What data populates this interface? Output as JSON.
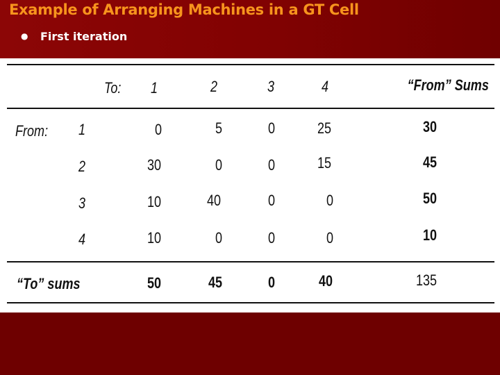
{
  "slide": {
    "title": "Example of Arranging Machines in a GT Cell",
    "bullets": [
      "First iteration"
    ],
    "colors": {
      "title": "#f7941d",
      "background": "#6e0000",
      "header_gradient_start": "#8c0606",
      "header_gradient_end": "#700000",
      "bullet_text": "#ffffff"
    }
  },
  "table": {
    "to_label": "To:",
    "from_label": "From:",
    "column_headers": [
      "1",
      "2",
      "3",
      "4"
    ],
    "from_sums_header": "“From” Sums",
    "rows": [
      {
        "machine": "1",
        "values": [
          "0",
          "5",
          "0",
          "25"
        ],
        "from_sum": "30"
      },
      {
        "machine": "2",
        "values": [
          "30",
          "0",
          "0",
          "15"
        ],
        "from_sum": "45"
      },
      {
        "machine": "3",
        "values": [
          "10",
          "40",
          "0",
          "0"
        ],
        "from_sum": "50"
      },
      {
        "machine": "4",
        "values": [
          "10",
          "0",
          "0",
          "0"
        ],
        "from_sum": "10"
      }
    ],
    "to_sums_label": "“To” sums",
    "to_sums": [
      "50",
      "45",
      "0",
      "40"
    ],
    "grand_total": "135"
  }
}
